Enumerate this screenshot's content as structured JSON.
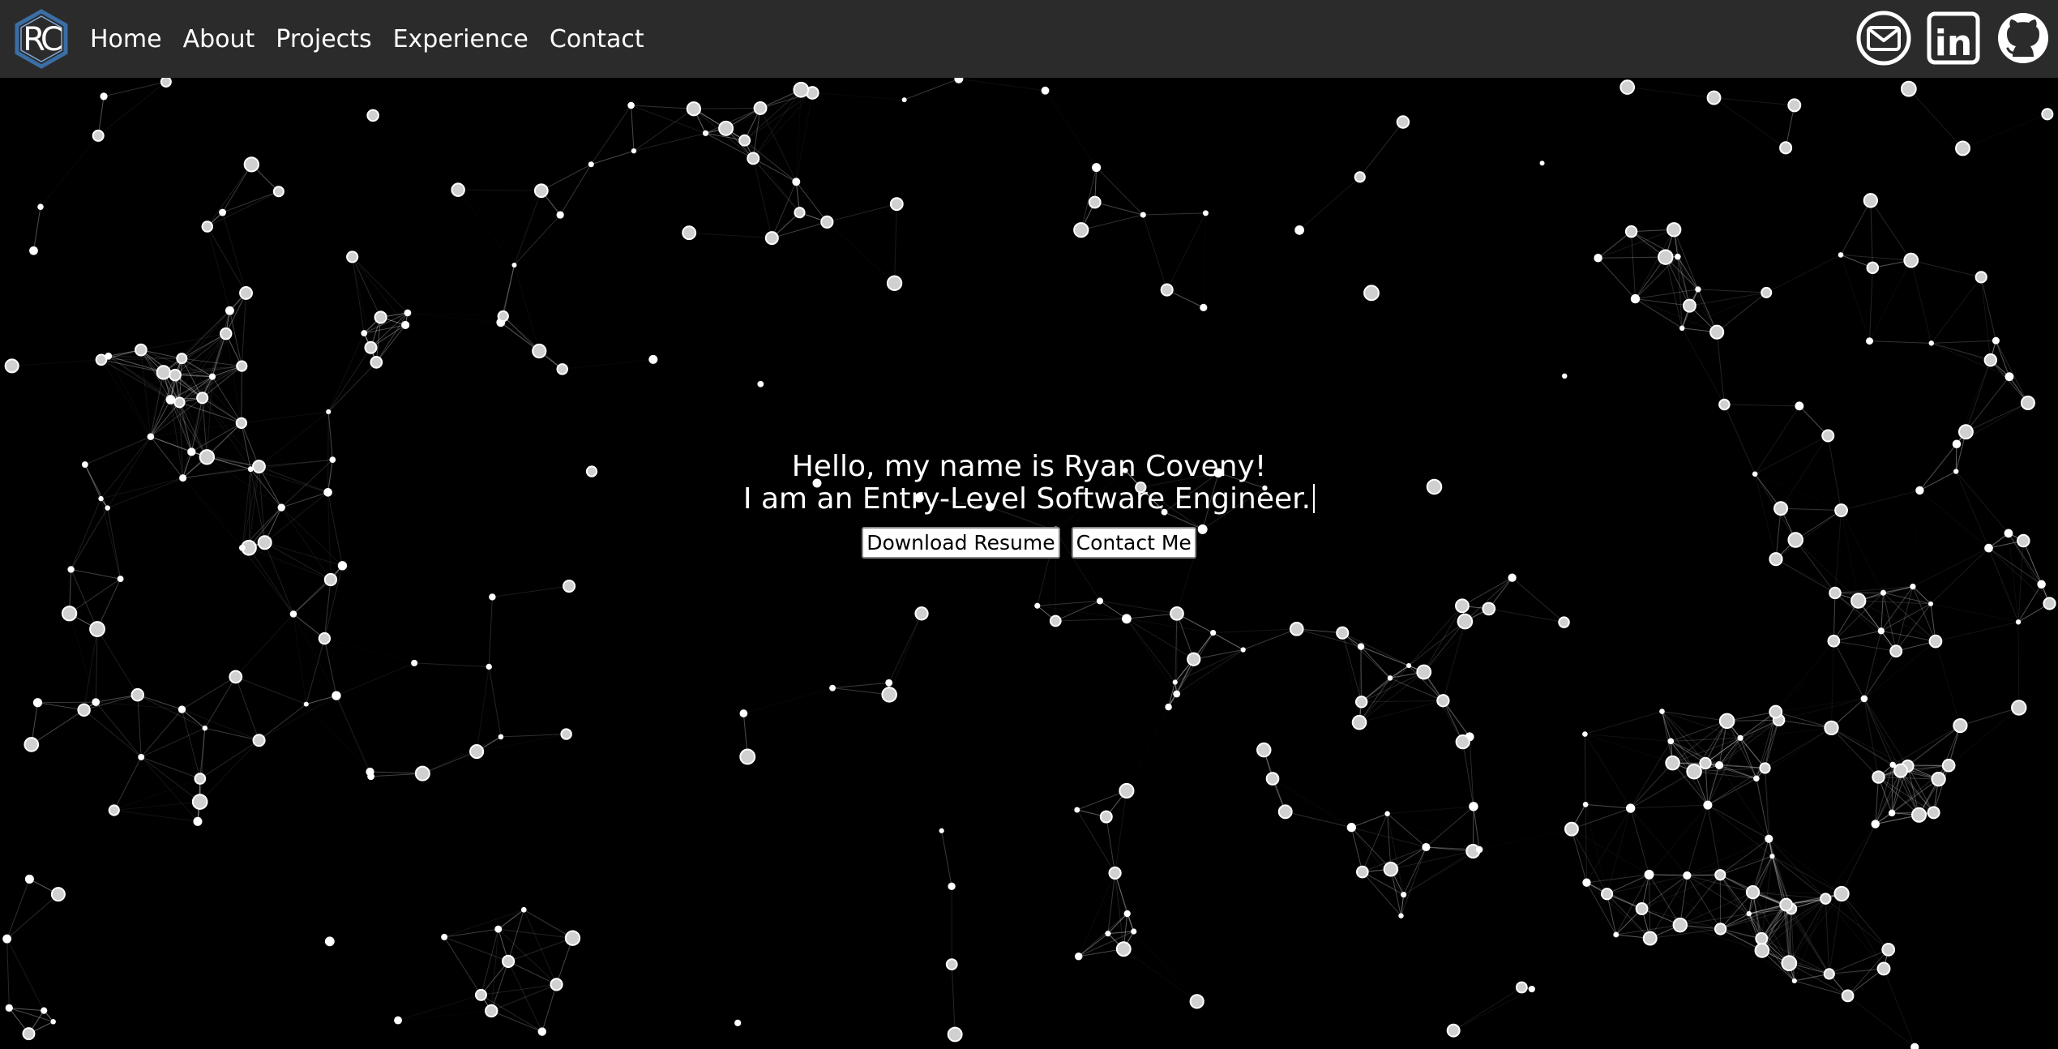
{
  "nav": {
    "logo_text": "RC",
    "links": [
      {
        "label": "Home"
      },
      {
        "label": "About"
      },
      {
        "label": "Projects"
      },
      {
        "label": "Experience"
      },
      {
        "label": "Contact"
      }
    ],
    "socials": [
      {
        "icon": "envelope-icon"
      },
      {
        "icon": "linkedin-icon",
        "text": "in"
      },
      {
        "icon": "github-icon"
      }
    ]
  },
  "hero": {
    "greeting": "Hello, my name is Ryan Coveny!",
    "tagline": "I am an Entry-Level Software Engineer.",
    "download_label": "Download Resume",
    "contact_label": "Contact Me"
  },
  "colors": {
    "navbar": "#2b2b2b",
    "background": "#000000",
    "text": "#ffffff",
    "logo_accent": "#3a6ea5"
  }
}
